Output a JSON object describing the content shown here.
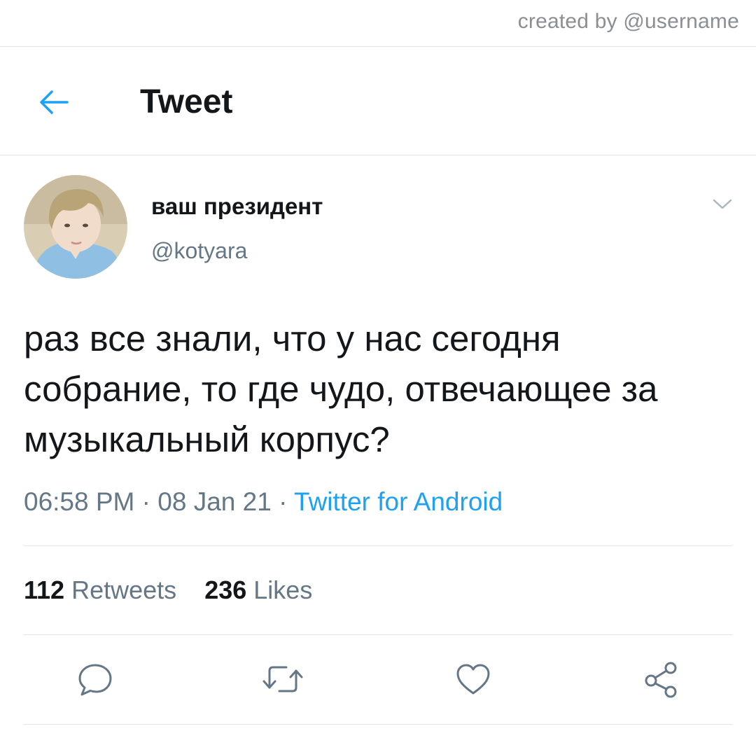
{
  "watermark": "created by @username",
  "header": {
    "title": "Tweet"
  },
  "tweet": {
    "display_name": "ваш президент",
    "handle": "@kotyara",
    "text": "раз все знали, что у нас сегодня собрание, то где чудо, отвечающее за музыкальный корпус?",
    "time": "06:58 PM",
    "separator": " · ",
    "date": "08 Jan 21",
    "source": "Twitter for Android"
  },
  "stats": {
    "retweets_count": "112",
    "retweets_label": "Retweets",
    "likes_count": "236",
    "likes_label": "Likes"
  },
  "icons": {
    "back": "arrow-left-icon",
    "more": "chevron-down-icon",
    "reply": "reply-icon",
    "retweet": "retweet-icon",
    "like": "heart-icon",
    "share": "share-icon"
  },
  "colors": {
    "accent": "#1da1f2",
    "text_primary": "#14171a",
    "text_secondary": "#657786",
    "divider": "#e1e6ea"
  }
}
